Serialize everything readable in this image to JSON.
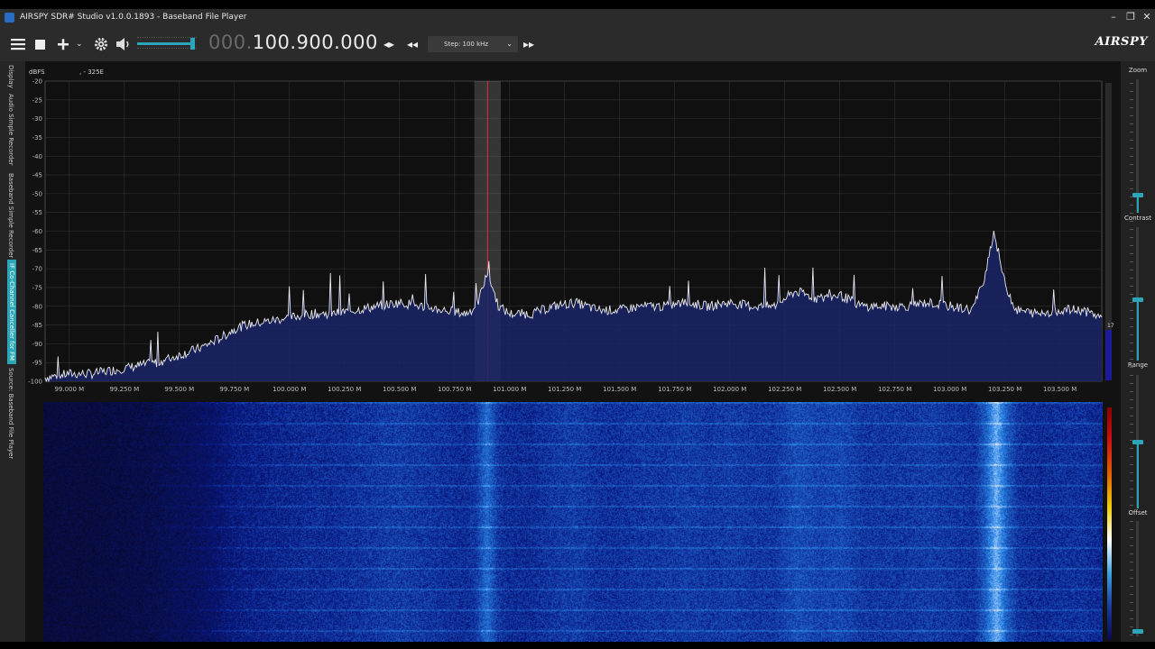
{
  "window": {
    "title": "AIRSPY SDR# Studio v1.0.0.1893 - Baseband File Player",
    "minimize": "–",
    "restore": "❐",
    "close": "✕"
  },
  "toolbar": {
    "menu_icon": "hamburger-menu-icon",
    "stop_icon": "stop-icon",
    "add_icon": "plus-icon",
    "settings_icon": "gear-icon",
    "volume_icon": "speaker-icon",
    "volume_level": 0.95,
    "frequency_prefix": "000.",
    "frequency_main": "100.900.000",
    "step_label": "Step: 100 kHz",
    "brand": "AIRSPY"
  },
  "sidebar": {
    "tabs": [
      {
        "label": "Display"
      },
      {
        "label": "Audio Simple Recorder"
      },
      {
        "label": "Baseband Simple Recorder"
      },
      {
        "label": "IF Co-Channel Canceller for FM",
        "active": true
      },
      {
        "label": "Source: Baseband File Player"
      }
    ]
  },
  "rightpanel": {
    "zoom_label": "Zoom",
    "contrast_label": "Contrast",
    "range_label": "Range",
    "offset_label": "Offset"
  },
  "spectrum": {
    "unit_label": "dBFS",
    "cursor_readout": ",    - 325E",
    "gain_marker": "17",
    "accent_color": "#2aa6b8"
  },
  "chart_data": {
    "type": "area",
    "ylabel": "dBFS",
    "ylim": [
      -100,
      -20
    ],
    "yticks": [
      -20,
      -25,
      -30,
      -35,
      -40,
      -45,
      -50,
      -55,
      -60,
      -65,
      -70,
      -75,
      -80,
      -85,
      -90,
      -95,
      -100
    ],
    "xlim": [
      98.89,
      103.69
    ],
    "xticks": [
      "99.000 M",
      "99.250 M",
      "99.500 M",
      "99.750 M",
      "100.000 M",
      "100.250 M",
      "100.500 M",
      "100.750 M",
      "101.000 M",
      "101.250 M",
      "101.500 M",
      "101.750 M",
      "102.000 M",
      "102.250 M",
      "102.500 M",
      "102.750 M",
      "103.000 M",
      "103.250 M",
      "103.500 M"
    ],
    "tuned_mhz": 100.9,
    "filter_band_mhz": [
      100.84,
      100.96
    ],
    "grid": true,
    "series": [
      {
        "x": [
          98.89,
          99.0,
          99.1,
          99.2,
          99.3,
          99.4,
          99.5,
          99.6,
          99.7,
          99.75,
          99.8,
          99.9,
          100.0,
          100.1,
          100.2,
          100.3,
          100.4,
          100.5,
          100.6,
          100.7,
          100.8,
          100.85,
          100.9,
          100.95,
          101.0,
          101.1,
          101.2,
          101.3,
          101.4,
          101.5,
          101.6,
          101.7,
          101.8,
          101.9,
          102.0,
          102.1,
          102.2,
          102.3,
          102.4,
          102.5,
          102.6,
          102.7,
          102.8,
          102.9,
          103.0,
          103.1,
          103.15,
          103.2,
          103.25,
          103.3,
          103.4,
          103.5,
          103.6,
          103.69
        ],
        "y": [
          -99,
          -98,
          -98,
          -97,
          -96,
          -95,
          -93,
          -91,
          -88,
          -86,
          -85,
          -84,
          -83,
          -82,
          -82,
          -81,
          -80,
          -79,
          -80,
          -81,
          -82,
          -80,
          -71,
          -80,
          -82,
          -82,
          -80,
          -79,
          -81,
          -81,
          -80,
          -80,
          -79,
          -80,
          -79,
          -80,
          -80,
          -76,
          -78,
          -77,
          -80,
          -80,
          -80,
          -79,
          -80,
          -81,
          -74,
          -60,
          -74,
          -81,
          -82,
          -81,
          -81,
          -83
        ]
      }
    ]
  }
}
